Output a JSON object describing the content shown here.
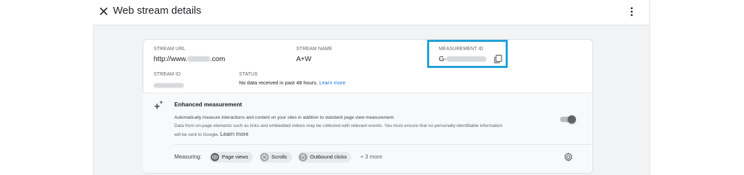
{
  "header": {
    "title": "Web stream details"
  },
  "stream": {
    "url_label": "STREAM URL",
    "url_prefix": "http://www.",
    "url_suffix": ".com",
    "name_label": "STREAM NAME",
    "name_value": "A+W",
    "measurement_label": "MEASUREMENT ID",
    "measurement_prefix": "G-",
    "id_label": "STREAM ID",
    "status_label": "STATUS",
    "status_text": "No data received in past 48 hours.",
    "status_link": "Learn more"
  },
  "enhanced": {
    "title": "Enhanced measurement",
    "desc_line1": "Automatically measure interactions and content on your sites in addition to standard page view measurement.",
    "desc_line2": "Data from on-page elements such as links and embedded videos may be collected with relevant events. You must ensure that no personally-identifiable information",
    "desc_line3": "will be sent to Google.",
    "learn_more": "Learn more",
    "enabled": true,
    "measuring_label": "Measuring:",
    "chips": [
      "Page views",
      "Scrolls",
      "Outbound clicks"
    ],
    "more_text": "+ 3 more"
  },
  "icons": [
    "close-icon",
    "more-vert-icon",
    "copy-icon",
    "sparkle-icon",
    "eye-icon",
    "scroll-icon",
    "click-icon",
    "gear-icon"
  ],
  "colors": {
    "highlight_border": "#1da1d8",
    "link": "#1a73e8",
    "toggle_knob": "#5f6368"
  }
}
